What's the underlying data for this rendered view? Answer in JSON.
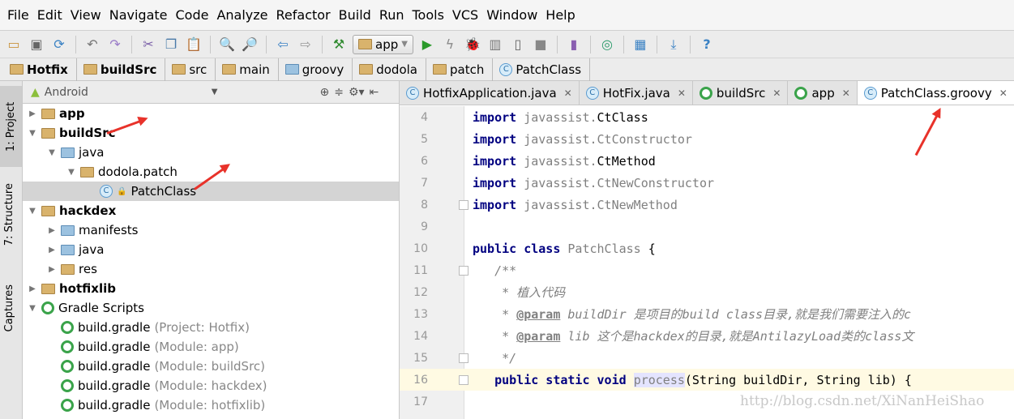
{
  "menu": [
    "File",
    "Edit",
    "View",
    "Navigate",
    "Code",
    "Analyze",
    "Refactor",
    "Build",
    "Run",
    "Tools",
    "VCS",
    "Window",
    "Help"
  ],
  "toolbar": {
    "run_config": "app"
  },
  "breadcrumb": [
    "Hotfix",
    "buildSrc",
    "src",
    "main",
    "groovy",
    "dodola",
    "patch",
    "PatchClass"
  ],
  "side_tabs": [
    "1: Project",
    "7: Structure",
    "Captures"
  ],
  "panel": {
    "view": "Android"
  },
  "tree": [
    {
      "label": "app",
      "extra": "",
      "level": 0,
      "bold": true,
      "icon": "module-folder",
      "arrow": "right"
    },
    {
      "label": "buildSrc",
      "extra": "",
      "level": 0,
      "bold": true,
      "icon": "module-folder",
      "arrow": "down"
    },
    {
      "label": "java",
      "extra": "",
      "level": 1,
      "bold": false,
      "icon": "source-folder",
      "arrow": "down"
    },
    {
      "label": "dodola.patch",
      "extra": "",
      "level": 2,
      "bold": false,
      "icon": "package-folder",
      "arrow": "down"
    },
    {
      "label": "PatchClass",
      "extra": "",
      "level": 3,
      "bold": false,
      "icon": "class",
      "arrow": "",
      "selected": true
    },
    {
      "label": "hackdex",
      "extra": "",
      "level": 0,
      "bold": true,
      "icon": "module-folder",
      "arrow": "down"
    },
    {
      "label": "manifests",
      "extra": "",
      "level": 1,
      "bold": false,
      "icon": "source-folder",
      "arrow": "right"
    },
    {
      "label": "java",
      "extra": "",
      "level": 1,
      "bold": false,
      "icon": "source-folder",
      "arrow": "right"
    },
    {
      "label": "res",
      "extra": "",
      "level": 1,
      "bold": false,
      "icon": "res-folder",
      "arrow": "right"
    },
    {
      "label": "hotfixlib",
      "extra": "",
      "level": 0,
      "bold": true,
      "icon": "module-folder",
      "arrow": "right"
    },
    {
      "label": "Gradle Scripts",
      "extra": "",
      "level": 0,
      "bold": false,
      "icon": "gradle",
      "arrow": "down"
    },
    {
      "label": "build.gradle",
      "extra": "(Project: Hotfix)",
      "level": 1,
      "bold": false,
      "icon": "gradle",
      "arrow": ""
    },
    {
      "label": "build.gradle",
      "extra": "(Module: app)",
      "level": 1,
      "bold": false,
      "icon": "gradle",
      "arrow": ""
    },
    {
      "label": "build.gradle",
      "extra": "(Module: buildSrc)",
      "level": 1,
      "bold": false,
      "icon": "gradle",
      "arrow": ""
    },
    {
      "label": "build.gradle",
      "extra": "(Module: hackdex)",
      "level": 1,
      "bold": false,
      "icon": "gradle",
      "arrow": ""
    },
    {
      "label": "build.gradle",
      "extra": "(Module: hotfixlib)",
      "level": 1,
      "bold": false,
      "icon": "gradle",
      "arrow": ""
    }
  ],
  "tabs": [
    {
      "label": "HotfixApplication.java",
      "icon": "class"
    },
    {
      "label": "HotFix.java",
      "icon": "class"
    },
    {
      "label": "buildSrc",
      "icon": "gradle"
    },
    {
      "label": "app",
      "icon": "gradle"
    },
    {
      "label": "PatchClass.groovy",
      "icon": "class",
      "active": true
    }
  ],
  "code": [
    {
      "n": "4",
      "html": "<span class='kw'>import</span> <span class='gr'>javassist.</span>CtClass"
    },
    {
      "n": "5",
      "html": "<span class='kw'>import</span> <span class='gr'>javassist.CtConstructor</span>"
    },
    {
      "n": "6",
      "html": "<span class='kw'>import</span> <span class='gr'>javassist.</span>CtMethod"
    },
    {
      "n": "7",
      "html": "<span class='kw'>import</span> <span class='gr'>javassist.CtNewConstructor</span>"
    },
    {
      "n": "8",
      "html": "<span class='kw'>import</span> <span class='gr'>javassist.CtNewMethod</span>"
    },
    {
      "n": "9",
      "html": ""
    },
    {
      "n": "10",
      "html": "<span class='kw'>public class</span> <span class='gr'>PatchClass</span> {"
    },
    {
      "n": "11",
      "html": "   <span class='cm'>/**</span>"
    },
    {
      "n": "12",
      "html": "    <span class='cm'>* 植入代码</span>"
    },
    {
      "n": "13",
      "html": "    <span class='cm'>* </span><span class='tag'>@param</span><span class='cm'> buildDir 是项目的build class目录,就是我们需要注入的c</span>"
    },
    {
      "n": "14",
      "html": "    <span class='cm'>* </span><span class='tag'>@param</span><span class='cm'> lib 这个是hackdex的目录,就是AntilazyLoad类的class文</span>"
    },
    {
      "n": "15",
      "html": "    <span class='cm'>*/</span>"
    },
    {
      "n": "16",
      "html": "   <span class='kw'>public static void</span> <span class='hl'>process</span>(String buildDir, String lib) {",
      "current": true
    },
    {
      "n": "17",
      "html": ""
    }
  ],
  "watermark": "http://blog.csdn.net/XiNanHeiShao"
}
